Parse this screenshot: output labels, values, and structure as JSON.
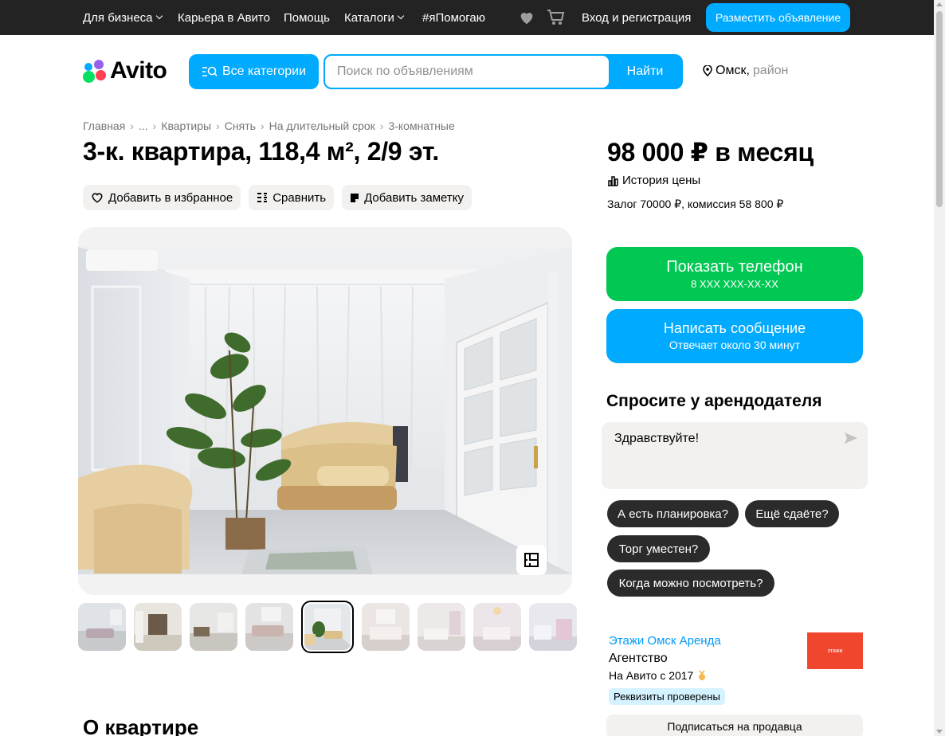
{
  "topbar": {
    "for_business": "Для бизнеса",
    "career": "Карьера в Авито",
    "help": "Помощь",
    "catalogs": "Каталоги",
    "pomogayu": "#яПомогаю",
    "login": "Вход и регистрация",
    "post_ad": "Разместить объявление",
    "icons": [
      "heart-icon",
      "cart-icon"
    ]
  },
  "header": {
    "logo_text": "Avito",
    "all_categories": "Все категории",
    "search_placeholder": "Поиск по объявлениям",
    "search_button": "Найти",
    "city": "Омск,",
    "district": "район"
  },
  "breadcrumbs": [
    "Главная",
    "...",
    "Квартиры",
    "Снять",
    "На длительный срок",
    "3-комнатные"
  ],
  "listing": {
    "title": "3-к. квартира, 118,4 м², 2/9 эт.",
    "actions": {
      "favorite": "Добавить в избранное",
      "compare": "Сравнить",
      "note": "Добавить заметку"
    },
    "thumbnail_count": 9,
    "active_thumbnail": 5,
    "section_title": "О квартире"
  },
  "sidebar": {
    "price": "98 000 ₽ в месяц",
    "price_history": "История цены",
    "deposit": "Залог 70000 ₽, комиссия 58 800 ₽",
    "show_phone": "Показать телефон",
    "phone_masked": "8 XXX XXX-XX-XX",
    "write_message": "Написать сообщение",
    "reply_time": "Отвечает около 30 минут",
    "ask_title": "Спросите у арендодателя",
    "ask_text": "Здравствуйте!",
    "quick_questions": [
      "А есть планировка?",
      "Ещё сдаёте?",
      "Торг уместен?",
      "Когда можно посмотреть?"
    ],
    "seller": {
      "name": "Этажи Омск Аренда",
      "type": "Агентство",
      "since": "На Авито с 2017",
      "verified": "Реквизиты проверены",
      "logo_text": "этажи",
      "subscribe": "Подписаться на продавца"
    }
  },
  "colors": {
    "accent_blue": "#00aaff",
    "green": "#00c853",
    "dark": "#232323",
    "chip": "#2b2b2b"
  }
}
